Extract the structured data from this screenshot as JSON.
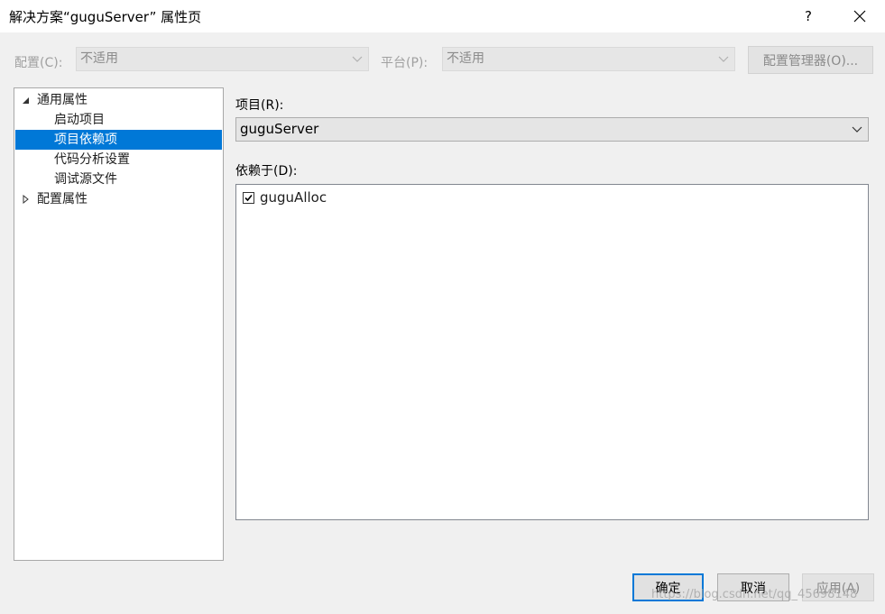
{
  "window": {
    "title": "解决方案“guguServer” 属性页",
    "help_label": "?",
    "close_icon": "close-icon"
  },
  "config_bar": {
    "configuration_label": "配置(C):",
    "configuration_value": "不适用",
    "platform_label": "平台(P):",
    "platform_value": "不适用",
    "config_manager_button": "配置管理器(O)..."
  },
  "tree": {
    "items": [
      {
        "label": "通用属性",
        "expanded": true
      },
      {
        "label": "启动项目"
      },
      {
        "label": "项目依赖项",
        "selected": true
      },
      {
        "label": "代码分析设置"
      },
      {
        "label": "调试源文件"
      },
      {
        "label": "配置属性",
        "expanded": false
      }
    ]
  },
  "main": {
    "project_label": "项目(R):",
    "project_value": "guguServer",
    "depends_label": "依赖于(D):",
    "dependencies": [
      {
        "name": "guguAlloc",
        "checked": true
      }
    ]
  },
  "buttons": {
    "ok": "确定",
    "cancel": "取消",
    "apply": "应用(A)"
  },
  "watermark": "https://blog.csdn.net/qq_45698148",
  "colors": {
    "accent": "#0078d7",
    "dialog_bg": "#f0f0f0",
    "disabled_text": "#8a8a8a"
  }
}
